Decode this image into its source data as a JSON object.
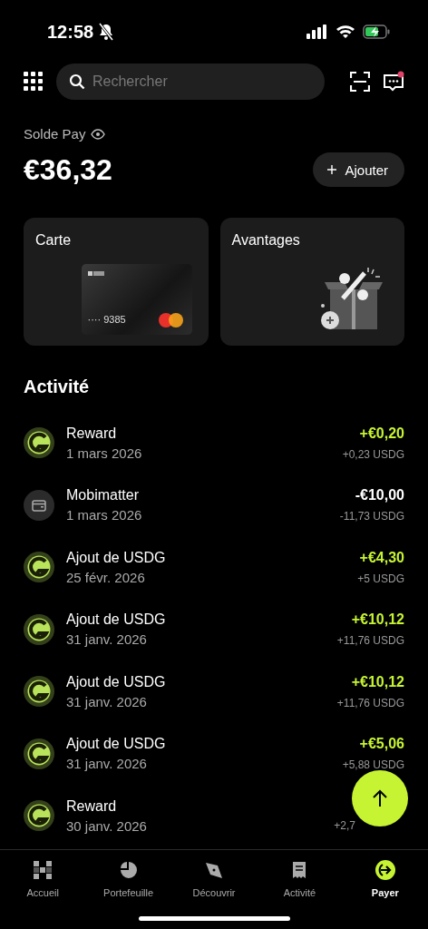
{
  "status_bar": {
    "time": "12:58",
    "silent": true
  },
  "search": {
    "placeholder": "Rechercher"
  },
  "notifications": {
    "unread": true
  },
  "balance": {
    "label": "Solde Pay",
    "amount": "€36,32",
    "add_button": "Ajouter"
  },
  "cards": [
    {
      "kind": "card",
      "title": "Carte",
      "card_number": "···· 9385"
    },
    {
      "kind": "perks",
      "title": "Avantages"
    }
  ],
  "activity": {
    "title": "Activité",
    "items": [
      {
        "kind": "token",
        "title": "Reward",
        "date": "1 mars 2026",
        "amount": "+€0,20",
        "sub": "+0,23 USDG",
        "positive": true
      },
      {
        "kind": "card",
        "title": "Mobimatter",
        "date": "1 mars 2026",
        "amount": "-€10,00",
        "sub": "-11,73 USDG",
        "positive": false
      },
      {
        "kind": "token",
        "title": "Ajout de USDG",
        "date": "25 févr. 2026",
        "amount": "+€4,30",
        "sub": "+5 USDG",
        "positive": true
      },
      {
        "kind": "token",
        "title": "Ajout de USDG",
        "date": "31 janv. 2026",
        "amount": "+€10,12",
        "sub": "+11,76 USDG",
        "positive": true
      },
      {
        "kind": "token",
        "title": "Ajout de USDG",
        "date": "31 janv. 2026",
        "amount": "+€10,12",
        "sub": "+11,76 USDG",
        "positive": true
      },
      {
        "kind": "token",
        "title": "Ajout de USDG",
        "date": "31 janv. 2026",
        "amount": "+€5,06",
        "sub": "+5,88 USDG",
        "positive": true
      },
      {
        "kind": "token",
        "title": "Reward",
        "date": "30 janv. 2026",
        "sub": "+2,7"
      }
    ]
  },
  "tabs": [
    {
      "kind": "home",
      "label": "Accueil",
      "selected": false
    },
    {
      "kind": "portfolio",
      "label": "Portefeuille",
      "selected": false
    },
    {
      "kind": "discover",
      "label": "Découvrir",
      "selected": false
    },
    {
      "kind": "activity",
      "label": "Activité",
      "selected": false
    },
    {
      "kind": "pay",
      "label": "Payer",
      "selected": true
    }
  ]
}
